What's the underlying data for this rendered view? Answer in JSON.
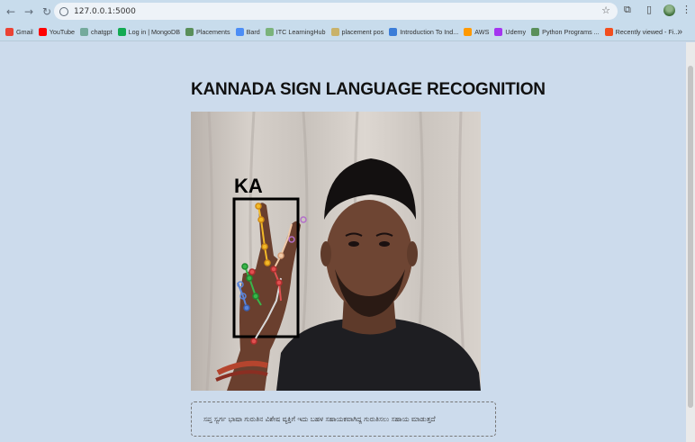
{
  "browser": {
    "url": "127.0.0.1:5000",
    "bookmarks": [
      {
        "label": "Gmail",
        "color": "#ea4335"
      },
      {
        "label": "YouTube",
        "color": "#ff0000"
      },
      {
        "label": "chatgpt",
        "color": "#74aa9c"
      },
      {
        "label": "Log in | MongoDB",
        "color": "#13aa52"
      },
      {
        "label": "Placements",
        "color": "#5a8f5a"
      },
      {
        "label": "Bard",
        "color": "#4c8df6"
      },
      {
        "label": "ITC LearningHub",
        "color": "#7bb37b"
      },
      {
        "label": "placement pos",
        "color": "#c9b26a"
      },
      {
        "label": "Introduction To Ind...",
        "color": "#3b7dd8"
      },
      {
        "label": "AWS",
        "color": "#ff9900"
      },
      {
        "label": "Udemy",
        "color": "#a435f0"
      },
      {
        "label": "Python Programs ...",
        "color": "#5a8f5a"
      },
      {
        "label": "Recently viewed - Fi...",
        "color": "#f24e1e"
      }
    ]
  },
  "page": {
    "title": "KANNADA SIGN LANGUAGE RECOGNITION",
    "video": {
      "detected_label": "KA"
    },
    "result_text": "ಸಪ್ತ ಸ್ವರ್ಗ ಭಾಷಾ ಗುರುತಿನ ವಿಶೇಷ ವ್ಯಕ್ತಿಗೆ ಇದು ಬಹಳ ಸಹಾಯಕವಾಗಿದ್ದ ಗುರುತಿಸಲು ಸಹಾಯ ಮಾಡುತ್ತದೆ"
  }
}
